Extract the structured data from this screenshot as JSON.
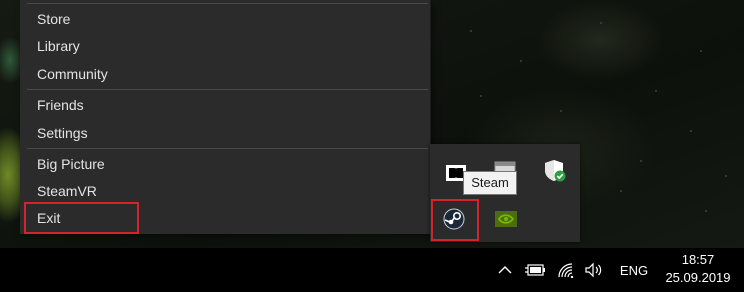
{
  "menu": {
    "items": [
      {
        "label": "Store"
      },
      {
        "label": "Library"
      },
      {
        "label": "Community"
      },
      {
        "label": "Friends"
      },
      {
        "label": "Settings"
      },
      {
        "label": "Big Picture"
      },
      {
        "label": "SteamVR"
      },
      {
        "label": "Exit"
      }
    ]
  },
  "tray_flyout": {
    "icons": [
      "dolby-audio-icon",
      "app-window-icon",
      "windows-security-icon",
      "steam-icon",
      "nvidia-icon"
    ],
    "tooltip": "Steam"
  },
  "taskbar": {
    "icons": [
      "show-hidden-icons-chevron-icon",
      "battery-icon",
      "wifi-icon",
      "volume-icon"
    ],
    "language": "ENG",
    "time": "18:57",
    "date": "25.09.2019"
  },
  "colors": {
    "menu_bg": "#2b2b2b",
    "highlight_red": "#d4242b",
    "taskbar_bg": "#000000",
    "security_green": "#2ea043"
  }
}
